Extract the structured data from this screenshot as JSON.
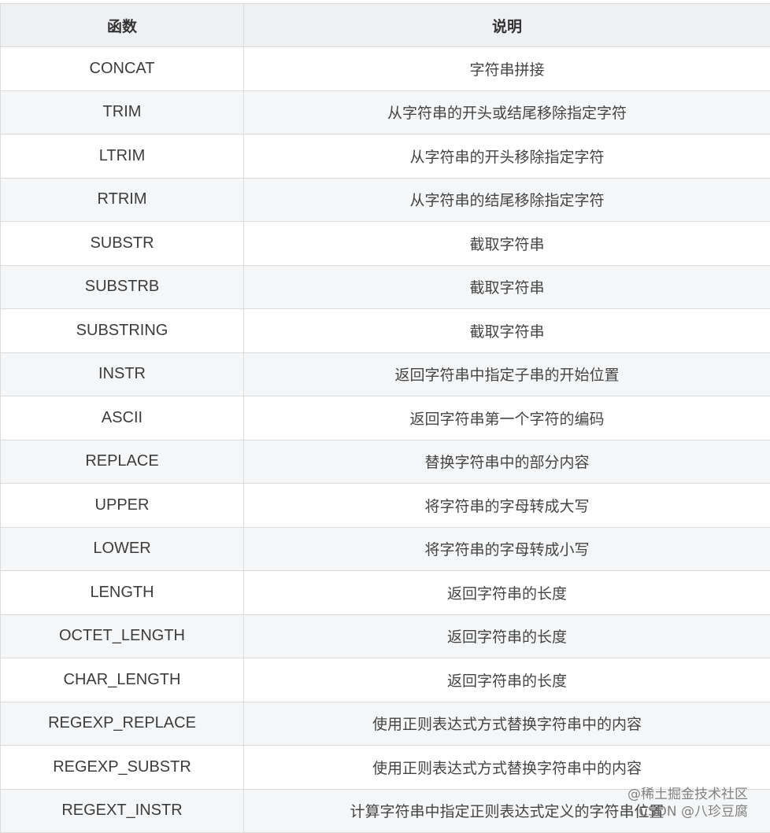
{
  "table": {
    "headers": [
      "函数",
      "说明"
    ],
    "rows": [
      {
        "fn": "CONCAT",
        "desc": "字符串拼接"
      },
      {
        "fn": "TRIM",
        "desc": "从字符串的开头或结尾移除指定字符"
      },
      {
        "fn": "LTRIM",
        "desc": "从字符串的开头移除指定字符"
      },
      {
        "fn": "RTRIM",
        "desc": "从字符串的结尾移除指定字符"
      },
      {
        "fn": "SUBSTR",
        "desc": "截取字符串"
      },
      {
        "fn": "SUBSTRB",
        "desc": "截取字符串"
      },
      {
        "fn": "SUBSTRING",
        "desc": "截取字符串"
      },
      {
        "fn": "INSTR",
        "desc": "返回字符串中指定子串的开始位置"
      },
      {
        "fn": "ASCII",
        "desc": "返回字符串第一个字符的编码"
      },
      {
        "fn": "REPLACE",
        "desc": "替换字符串中的部分内容"
      },
      {
        "fn": "UPPER",
        "desc": "将字符串的字母转成大写"
      },
      {
        "fn": "LOWER",
        "desc": "将字符串的字母转成小写"
      },
      {
        "fn": "LENGTH",
        "desc": "返回字符串的长度"
      },
      {
        "fn": "OCTET_LENGTH",
        "desc": "返回字符串的长度"
      },
      {
        "fn": "CHAR_LENGTH",
        "desc": "返回字符串的长度"
      },
      {
        "fn": "REGEXP_REPLACE",
        "desc": "使用正则表达式方式替换字符串中的内容"
      },
      {
        "fn": "REGEXP_SUBSTR",
        "desc": "使用正则表达式方式替换字符串中的内容"
      },
      {
        "fn": "REGEXT_INSTR",
        "desc": "计算字符串中指定正则表达式定义的字符串位置"
      }
    ]
  },
  "watermark": {
    "line1": "@稀土掘金技术社区",
    "line2": "CSDN @八珍豆腐"
  }
}
